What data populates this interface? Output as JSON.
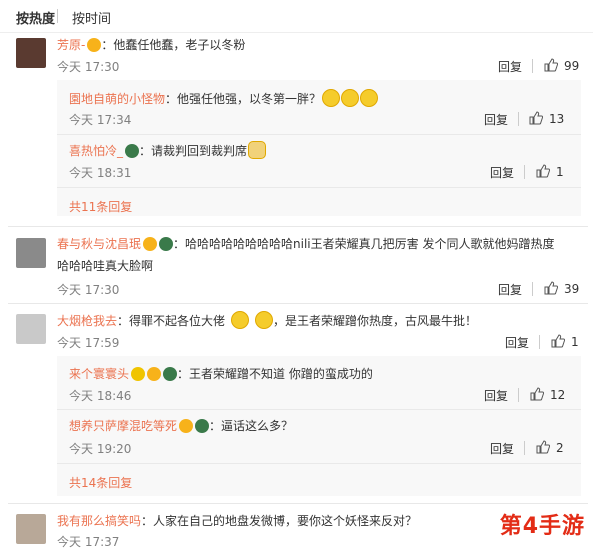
{
  "sort": {
    "hot": "按热度",
    "time": "按时间"
  },
  "comments": [
    {
      "user": "芳原-",
      "text": "：他蠢任他蠢，老子以冬粉",
      "time": "今天 17:30",
      "reply": "回复",
      "likes": "99",
      "subs": [
        {
          "user": "園地自萌的小怪物",
          "text": "：他强任他强，以冬第一胖？",
          "time": "今天 17:34",
          "reply": "回复",
          "likes": "13"
        },
        {
          "user": "喜热怕冷_",
          "text": "：请裁判回到裁判席",
          "time": "今天 18:31",
          "reply": "回复",
          "likes": "1"
        }
      ],
      "more": "共11条回复"
    },
    {
      "user": "春与秋与沈昌珉",
      "text1": "：哈哈哈哈哈哈哈哈哈nili王者荣耀真几把厉害 发个同人歌就他妈蹭热度",
      "text2": "哈哈哈哇真大脸啊",
      "time": "今天 17:30",
      "reply": "回复",
      "likes": "39"
    },
    {
      "user": "大烟枪我去",
      "text_a": "：得罪不起各位大佬",
      "text_b": "，是王者荣耀蹭你热度，古风最牛批！",
      "time": "今天 17:59",
      "reply": "回复",
      "likes": "1",
      "subs": [
        {
          "user": "来个寰寰头",
          "text": "：王者荣耀蹭不知道 你蹭的蛮成功的",
          "time": "今天 18:46",
          "reply": "回复",
          "likes": "12"
        },
        {
          "user": "想养只萨摩混吃等死",
          "text": "：逼话这么多？",
          "time": "今天 19:20",
          "reply": "回复",
          "likes": "2"
        }
      ],
      "more": "共14条回复"
    },
    {
      "user": "我有那么搞笑吗",
      "text": "：人家在自己的地盘发微博，要你这个妖怪来反对？",
      "time": "今天 17:37"
    }
  ],
  "watermark": "第4手游",
  "colors": {
    "name": "#eb7350",
    "time": "#808080",
    "reply_bg": "#f8f8f8"
  }
}
